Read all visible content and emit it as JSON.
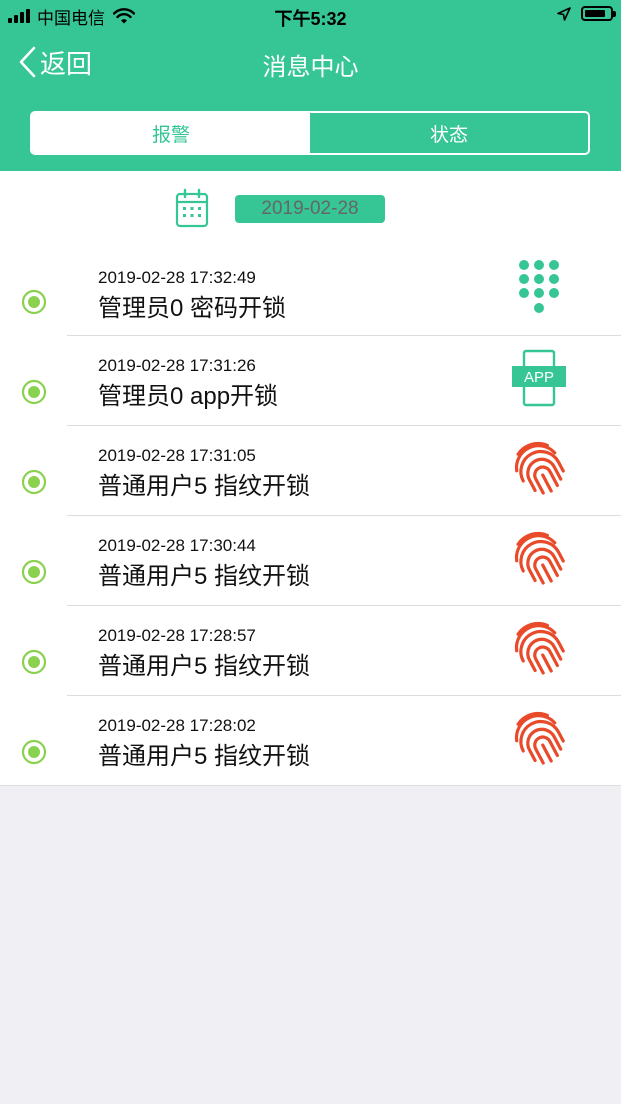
{
  "status_bar": {
    "carrier": "中国电信",
    "time": "下午5:32"
  },
  "nav": {
    "back_label": "返回",
    "title": "消息中心"
  },
  "tabs": [
    {
      "label": "报警",
      "active": true
    },
    {
      "label": "状态",
      "active": false
    }
  ],
  "date_filter": {
    "date": "2019-02-28"
  },
  "records": [
    {
      "time": "2019-02-28 17:32:49",
      "text": "管理员0 密码开锁",
      "icon": "keypad-icon"
    },
    {
      "time": "2019-02-28 17:31:26",
      "text": "管理员0 app开锁",
      "icon": "app-icon",
      "icon_text": "APP"
    },
    {
      "time": "2019-02-28 17:31:05",
      "text": "普通用户5 指纹开锁",
      "icon": "fingerprint-icon"
    },
    {
      "time": "2019-02-28 17:30:44",
      "text": "普通用户5 指纹开锁",
      "icon": "fingerprint-icon"
    },
    {
      "time": "2019-02-28 17:28:57",
      "text": "普通用户5 指纹开锁",
      "icon": "fingerprint-icon"
    },
    {
      "time": "2019-02-28 17:28:02",
      "text": "普通用户5 指纹开锁",
      "icon": "fingerprint-icon"
    }
  ],
  "colors": {
    "primary": "#36c595",
    "dot_green": "#8bd150",
    "fingerprint_red": "#e84a2a",
    "background": "#efeff4"
  }
}
